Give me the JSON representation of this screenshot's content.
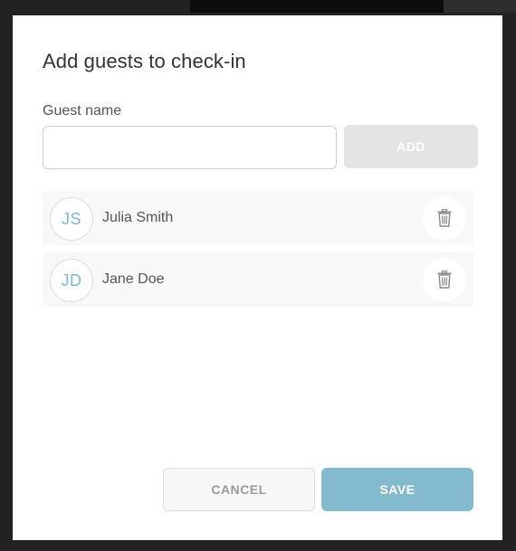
{
  "dialog": {
    "title": "Add guests to check-in"
  },
  "form": {
    "label": "Guest name",
    "input_value": "",
    "input_placeholder": "",
    "add_label": "ADD"
  },
  "guests": [
    {
      "initials": "JS",
      "name": "Julia Smith",
      "delete_icon": "trash-icon"
    },
    {
      "initials": "JD",
      "name": "Jane Doe",
      "delete_icon": "trash-icon"
    }
  ],
  "footer": {
    "cancel_label": "CANCEL",
    "save_label": "SAVE"
  },
  "colors": {
    "accent": "#84bacd",
    "avatar_text": "#7fb6c9",
    "disabled_button": "#e4e4e4",
    "row_background": "#f8f8f8",
    "backdrop": "#222222"
  }
}
